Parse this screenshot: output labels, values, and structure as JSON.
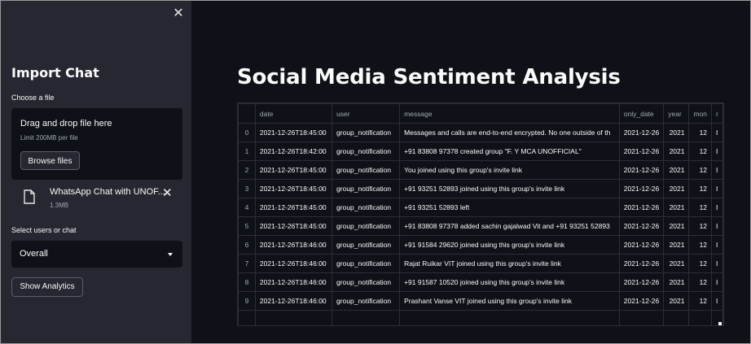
{
  "sidebar": {
    "close_glyph": "✕",
    "title": "Import Chat",
    "upload_label": "Choose a file",
    "dropzone_title": "Drag and drop file here",
    "dropzone_limit": "Limit 200MB per file",
    "browse_label": "Browse files",
    "file_name": "WhatsApp Chat with UNOF...",
    "file_size": "1.3MB",
    "remove_glyph": "✕",
    "select_label": "Select users or chat",
    "select_value": "Overall",
    "analytics_label": "Show Analytics"
  },
  "main": {
    "title": "Social Media Sentiment Analysis"
  },
  "table": {
    "columns": [
      "",
      "date",
      "user",
      "message",
      "only_date",
      "year",
      "mon",
      "r"
    ],
    "rows": [
      [
        "0",
        "2021-12-26T18:45:00",
        "group_notification",
        "Messages and calls are end-to-end encrypted. No one outside of th",
        "2021-12-26",
        "2021",
        "12",
        "I"
      ],
      [
        "1",
        "2021-12-26T18:42:00",
        "group_notification",
        "+91 83808 97378 created group \"F. Y  MCA UNOFFICIAL\"",
        "2021-12-26",
        "2021",
        "12",
        "I"
      ],
      [
        "2",
        "2021-12-26T18:45:00",
        "group_notification",
        "You joined using this group's invite link",
        "2021-12-26",
        "2021",
        "12",
        "I"
      ],
      [
        "3",
        "2021-12-26T18:45:00",
        "group_notification",
        "+91 93251 52893 joined using this group's invite link",
        "2021-12-26",
        "2021",
        "12",
        "I"
      ],
      [
        "4",
        "2021-12-26T18:45:00",
        "group_notification",
        "+91 93251 52893 left",
        "2021-12-26",
        "2021",
        "12",
        "I"
      ],
      [
        "5",
        "2021-12-26T18:45:00",
        "group_notification",
        "+91 83808 97378 added sachin gajalwad Vit and +91 93251 52893",
        "2021-12-26",
        "2021",
        "12",
        "I"
      ],
      [
        "6",
        "2021-12-26T18:46:00",
        "group_notification",
        "+91 91584 29620 joined using this group's invite link",
        "2021-12-26",
        "2021",
        "12",
        "I"
      ],
      [
        "7",
        "2021-12-26T18:46:00",
        "group_notification",
        "Rajat Ruikar VIT joined using this group's invite link",
        "2021-12-26",
        "2021",
        "12",
        "I"
      ],
      [
        "8",
        "2021-12-26T18:46:00",
        "group_notification",
        "+91 91587 10520 joined using this group's invite link",
        "2021-12-26",
        "2021",
        "12",
        "I"
      ],
      [
        "9",
        "2021-12-26T18:46:00",
        "group_notification",
        "Prashant Vanse VIT joined using this group's invite link",
        "2021-12-26",
        "2021",
        "12",
        "I"
      ]
    ]
  }
}
